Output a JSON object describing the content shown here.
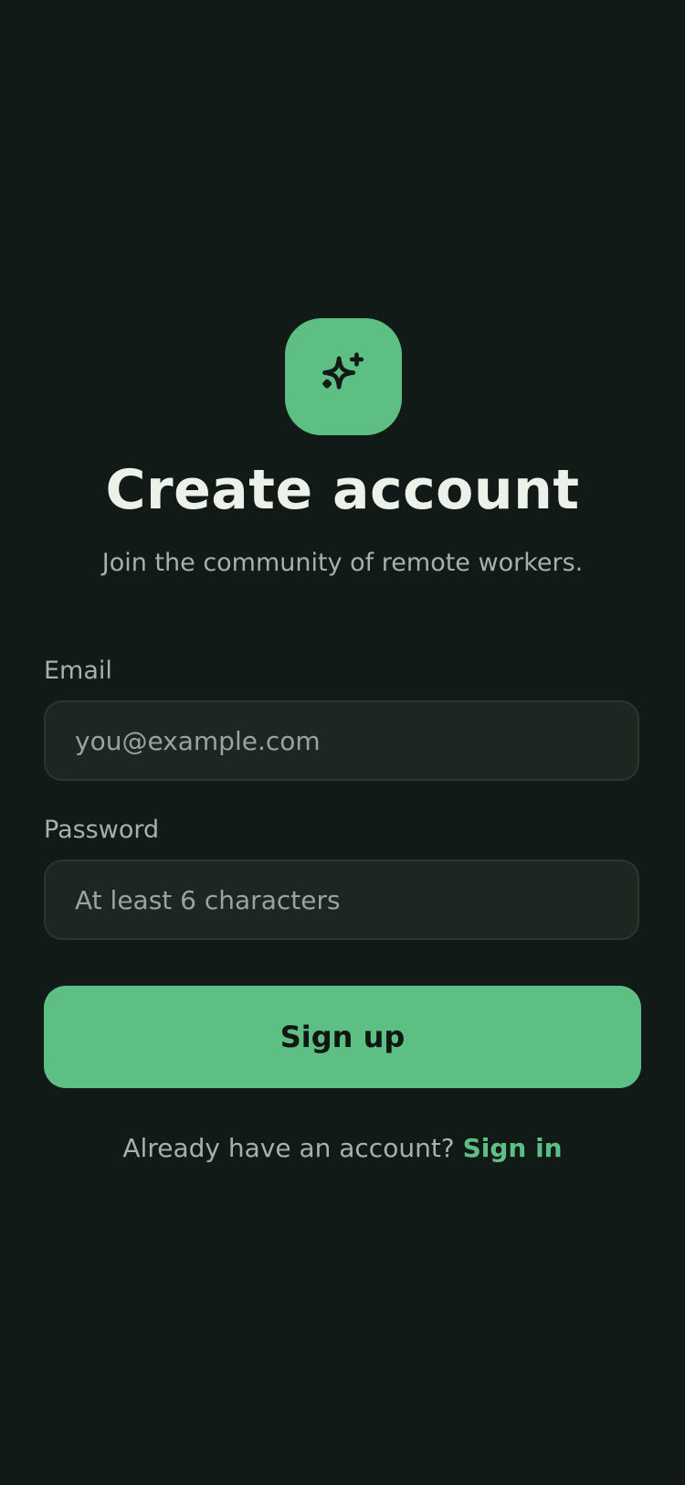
{
  "brand": {
    "accent_color": "#5ebf84",
    "background_color": "#121a17",
    "icon": "sparkles-icon"
  },
  "header": {
    "title": "Create account",
    "subtitle": "Join the community of remote workers."
  },
  "form": {
    "email": {
      "label": "Email",
      "value": "",
      "placeholder": "you@example.com"
    },
    "password": {
      "label": "Password",
      "value": "",
      "placeholder": "At least 6 characters"
    },
    "submit_label": "Sign up"
  },
  "footer": {
    "prompt": "Already have an account?",
    "link_label": "Sign in"
  }
}
